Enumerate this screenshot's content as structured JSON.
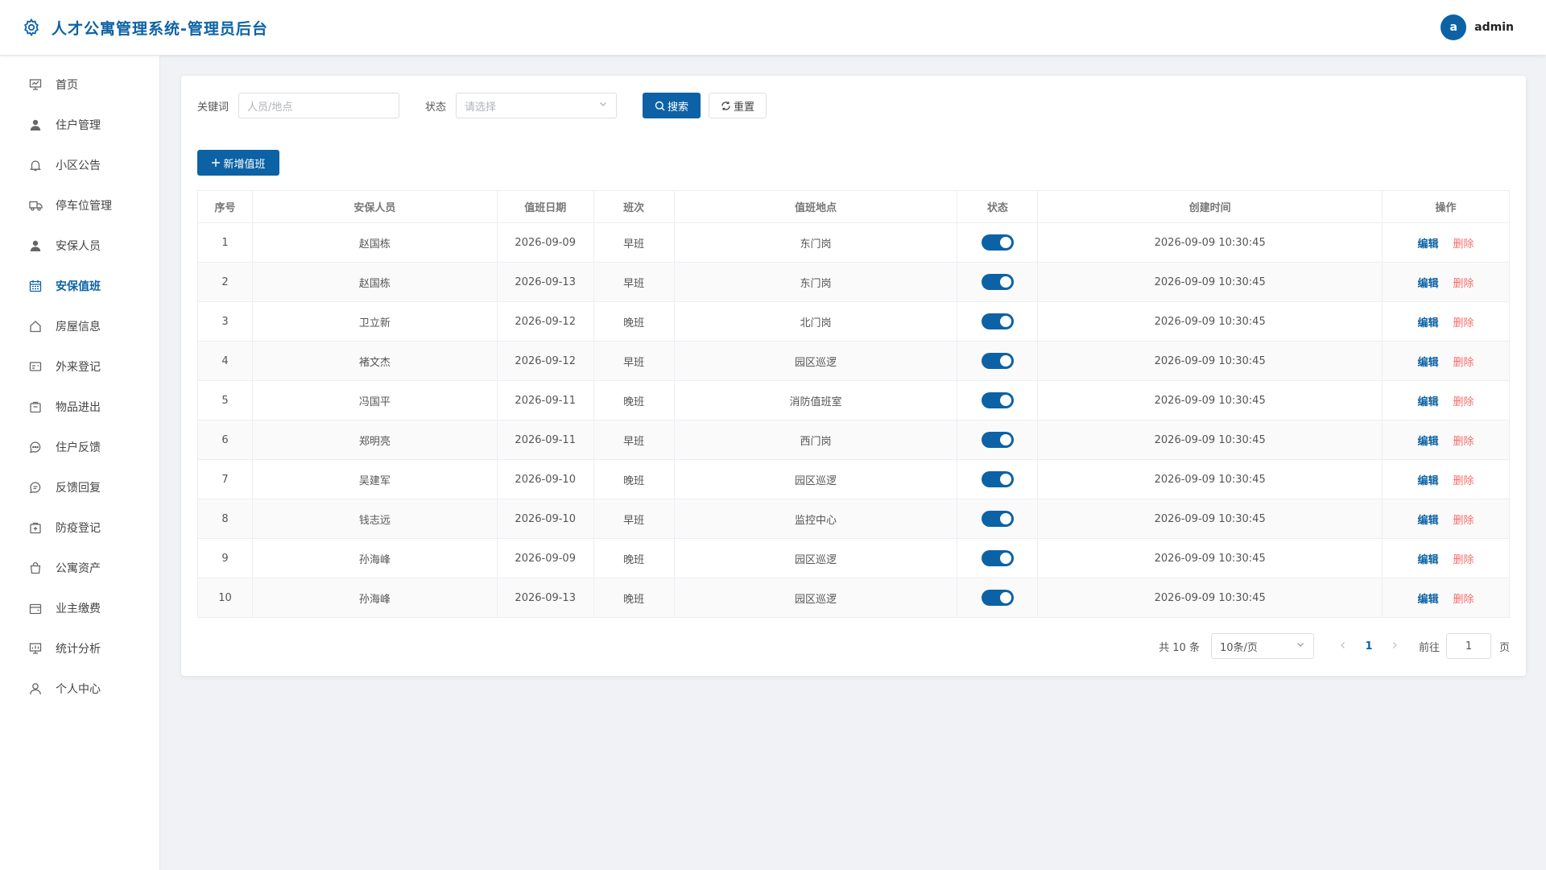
{
  "header": {
    "title": "人才公寓管理系统-管理员后台",
    "avatar_letter": "a",
    "username": "admin",
    "logo_icon": "gear-icon"
  },
  "colors": {
    "accent": "#0c62a5",
    "danger": "#f56c6c",
    "background": "#f0f2f5"
  },
  "sidebar": {
    "items": [
      {
        "label": "首页",
        "icon": "dashboard-icon"
      },
      {
        "label": "住户管理",
        "icon": "user-icon"
      },
      {
        "label": "小区公告",
        "icon": "bell-icon"
      },
      {
        "label": "停车位管理",
        "icon": "truck-icon"
      },
      {
        "label": "安保人员",
        "icon": "user-icon"
      },
      {
        "label": "安保值班",
        "icon": "calendar-icon",
        "active": true
      },
      {
        "label": "房屋信息",
        "icon": "house-icon"
      },
      {
        "label": "外来登记",
        "icon": "id-card-icon"
      },
      {
        "label": "物品进出",
        "icon": "box-icon"
      },
      {
        "label": "住户反馈",
        "icon": "chat-icon"
      },
      {
        "label": "反馈回复",
        "icon": "chat-reply-icon"
      },
      {
        "label": "防疫登记",
        "icon": "medical-kit-icon"
      },
      {
        "label": "公寓资产",
        "icon": "bag-icon"
      },
      {
        "label": "业主缴费",
        "icon": "wallet-icon"
      },
      {
        "label": "统计分析",
        "icon": "chart-icon"
      },
      {
        "label": "个人中心",
        "icon": "profile-icon"
      }
    ]
  },
  "filters": {
    "keyword_label": "关键词",
    "keyword_placeholder": "人员/地点",
    "status_label": "状态",
    "status_placeholder": "请选择",
    "search_label": "搜索",
    "reset_label": "重置"
  },
  "add_button_label": "新增值班",
  "table": {
    "columns": [
      "序号",
      "安保人员",
      "值班日期",
      "班次",
      "值班地点",
      "状态",
      "创建时间",
      "操作"
    ],
    "edit_label": "编辑",
    "delete_label": "删除",
    "rows": [
      {
        "index": "1",
        "person": "赵国栋",
        "date": "2026-09-09",
        "shift": "早班",
        "location": "东门岗",
        "created": "2026-09-09 10:30:45"
      },
      {
        "index": "2",
        "person": "赵国栋",
        "date": "2026-09-13",
        "shift": "早班",
        "location": "东门岗",
        "created": "2026-09-09 10:30:45"
      },
      {
        "index": "3",
        "person": "卫立新",
        "date": "2026-09-12",
        "shift": "晚班",
        "location": "北门岗",
        "created": "2026-09-09 10:30:45"
      },
      {
        "index": "4",
        "person": "褚文杰",
        "date": "2026-09-12",
        "shift": "早班",
        "location": "园区巡逻",
        "created": "2026-09-09 10:30:45"
      },
      {
        "index": "5",
        "person": "冯国平",
        "date": "2026-09-11",
        "shift": "晚班",
        "location": "消防值班室",
        "created": "2026-09-09 10:30:45"
      },
      {
        "index": "6",
        "person": "郑明亮",
        "date": "2026-09-11",
        "shift": "早班",
        "location": "西门岗",
        "created": "2026-09-09 10:30:45"
      },
      {
        "index": "7",
        "person": "吴建军",
        "date": "2026-09-10",
        "shift": "晚班",
        "location": "园区巡逻",
        "created": "2026-09-09 10:30:45"
      },
      {
        "index": "8",
        "person": "钱志远",
        "date": "2026-09-10",
        "shift": "早班",
        "location": "监控中心",
        "created": "2026-09-09 10:30:45"
      },
      {
        "index": "9",
        "person": "孙海峰",
        "date": "2026-09-09",
        "shift": "晚班",
        "location": "园区巡逻",
        "created": "2026-09-09 10:30:45"
      },
      {
        "index": "10",
        "person": "孙海峰",
        "date": "2026-09-13",
        "shift": "晚班",
        "location": "园区巡逻",
        "created": "2026-09-09 10:30:45"
      }
    ]
  },
  "pagination": {
    "total_text": "共 10 条",
    "page_size": "10条/页",
    "current_page": "1",
    "goto_label": "前往",
    "goto_value": "1",
    "page_suffix": "页"
  }
}
